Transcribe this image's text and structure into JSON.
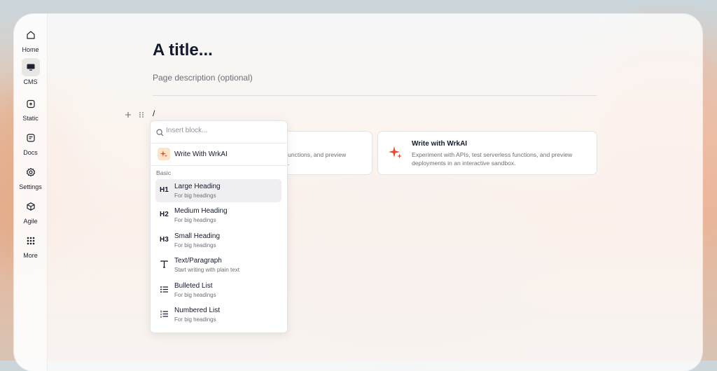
{
  "sidebar": {
    "items": [
      {
        "label": "Home",
        "icon": "home-icon",
        "active": false
      },
      {
        "label": "CMS",
        "icon": "monitor-icon",
        "active": true
      },
      {
        "label": "Static",
        "icon": "static-icon",
        "active": false
      },
      {
        "label": "Docs",
        "icon": "docs-icon",
        "active": false
      },
      {
        "label": "Settings",
        "icon": "gear-icon",
        "active": false
      },
      {
        "label": "Agile",
        "icon": "cube-icon",
        "active": false
      },
      {
        "label": "More",
        "icon": "grid-dots-icon",
        "active": false
      }
    ]
  },
  "editor": {
    "title": "A title...",
    "description_placeholder": "Page description (optional)",
    "block_text": "/"
  },
  "cards": [
    {
      "title": "",
      "description": "s functions, and preview deployments in an interactive sandbox.",
      "desc_line1": "s functions, and preview",
      "desc_line2": "ox."
    },
    {
      "title": "Write with WrkAI",
      "desc_line1": "Experiment with APIs, test serverless functions, and preview",
      "desc_line2": "deployments in an interactive sandbox."
    }
  ],
  "dropdown": {
    "search_placeholder": "Insert block...",
    "ai_label": "Write With WrkAI",
    "section": "Basic",
    "items": [
      {
        "key": "H1",
        "title": "Large Heading",
        "subtitle": "For big headings",
        "icon": "h1-icon"
      },
      {
        "key": "H2",
        "title": "Medium Heading",
        "subtitle": "For big headings",
        "icon": "h2-icon"
      },
      {
        "key": "H3",
        "title": "Small Heading",
        "subtitle": "For big headings",
        "icon": "h3-icon"
      },
      {
        "key": "",
        "title": "Text/Paragraph",
        "subtitle": "Start writing with plain text",
        "icon": "text-icon"
      },
      {
        "key": "",
        "title": "Bulleted List",
        "subtitle": "For big headings",
        "icon": "bulleted-list-icon"
      },
      {
        "key": "",
        "title": "Numbered List",
        "subtitle": "For big headings",
        "icon": "numbered-list-icon"
      }
    ]
  },
  "colors": {
    "accent": "#e8492f",
    "text": "#141a2e",
    "muted": "#6b6f78"
  }
}
